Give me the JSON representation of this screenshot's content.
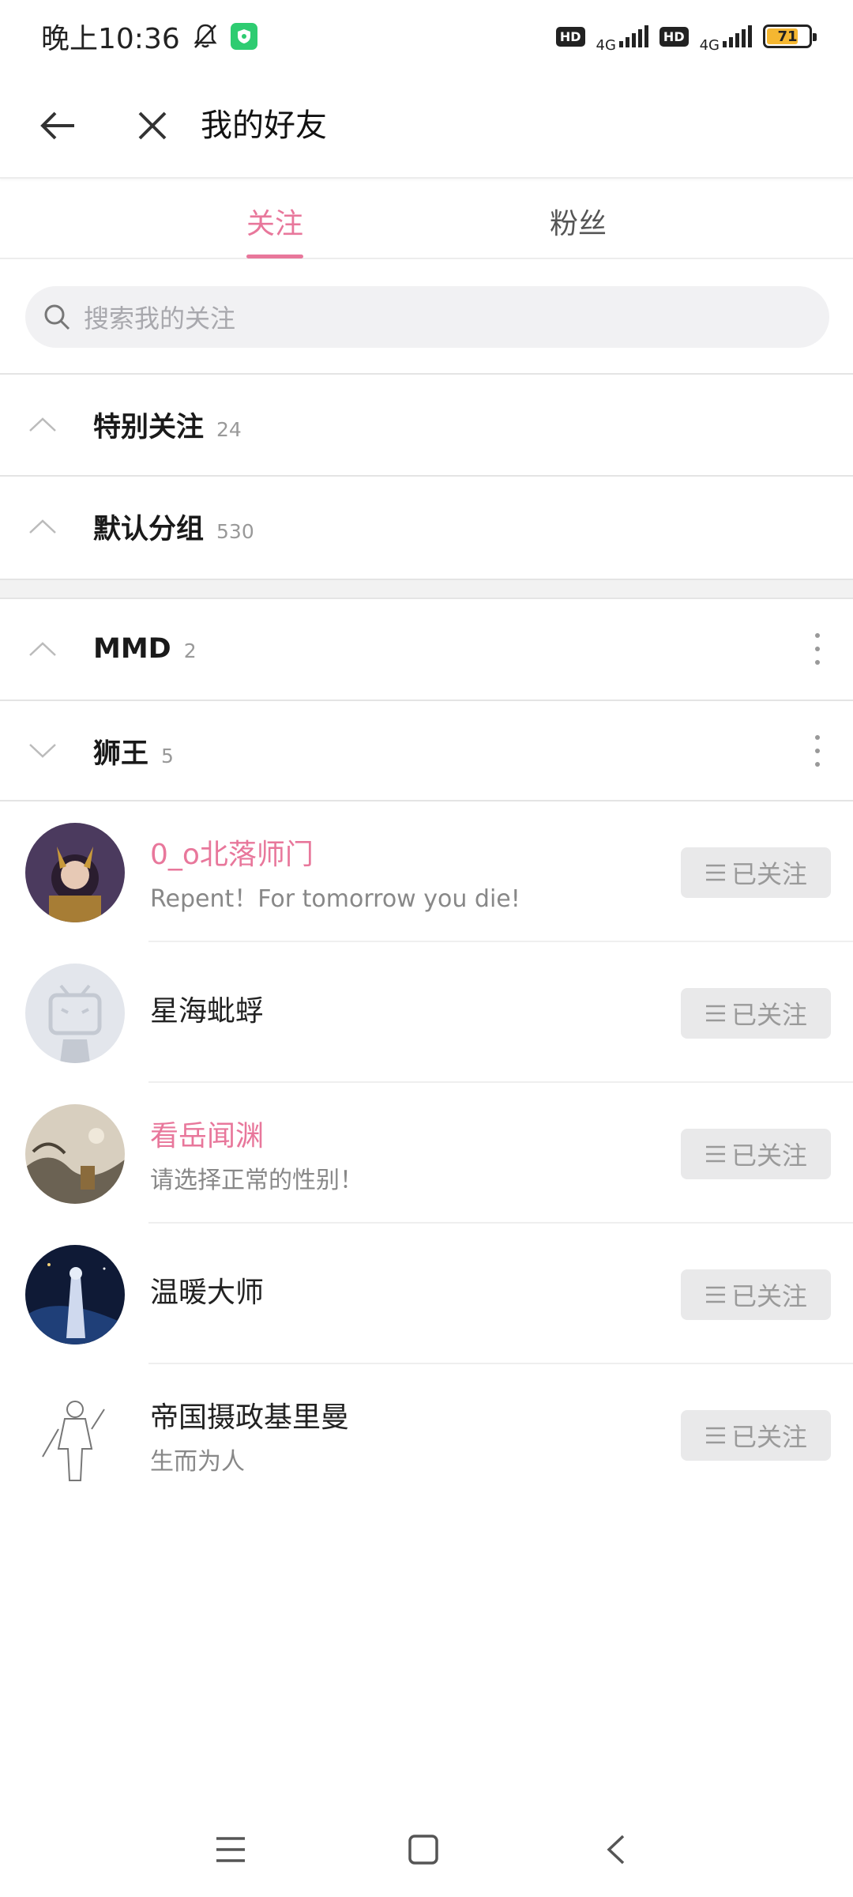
{
  "status_bar": {
    "time": "晚上10:36",
    "net_1": "4G",
    "net_2": "4G",
    "hd_1": "HD",
    "hd_2": "HD",
    "battery": "71",
    "battery_color": "#f5b731"
  },
  "header": {
    "title": "我的好友"
  },
  "tabs": [
    {
      "label": "关注",
      "active": true
    },
    {
      "label": "粉丝",
      "active": false
    }
  ],
  "search": {
    "placeholder": "搜索我的关注"
  },
  "groups": [
    {
      "name": "特别关注",
      "count": "24",
      "state": "collapsed"
    },
    {
      "name": "默认分组",
      "count": "530",
      "state": "collapsed"
    },
    {
      "name": "MMD",
      "count": "2",
      "state": "collapsed"
    },
    {
      "name": "狮王",
      "count": "5",
      "state": "expanded"
    }
  ],
  "users": [
    {
      "name": "0_o北落师门",
      "sign": "Repent！For tomorrow you die!",
      "vip": true,
      "button": "已关注"
    },
    {
      "name": "星海蚍蜉",
      "sign": "",
      "vip": false,
      "button": "已关注"
    },
    {
      "name": "看岳闻渊",
      "sign": "请选择正常的性别！",
      "vip": true,
      "button": "已关注"
    },
    {
      "name": "温暖大师",
      "sign": "",
      "vip": false,
      "button": "已关注"
    },
    {
      "name": "帝国摄政基里曼",
      "sign": "生而为人",
      "vip": false,
      "button": "已关注"
    }
  ],
  "colors": {
    "accent": "#e8779b",
    "button_bg": "#e9e9ea"
  }
}
